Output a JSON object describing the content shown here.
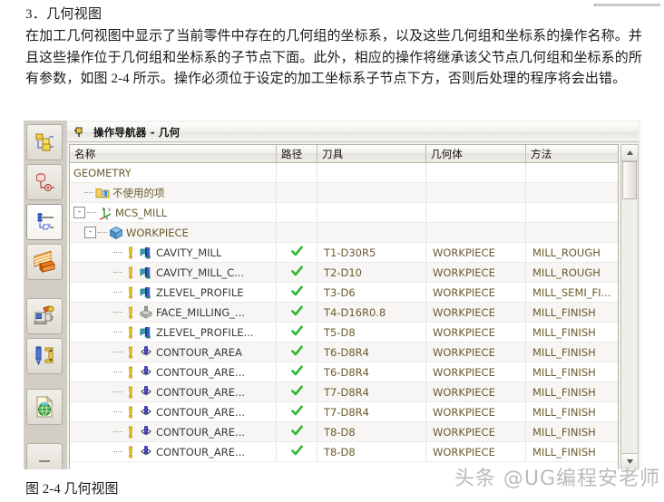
{
  "document": {
    "heading": "3．几何视图",
    "paragraph": "在加工几何视图中显示了当前零件中存在的几何组的坐标系，以及这些几何组和坐标系的操作名称。并且这些操作位于几何组和坐标系的子节点下面。此外，相应的操作将继承该父节点几何组和坐标系的所有参数，如图 2-4 所示。操作必须位于设定的加工坐标系子节点下方，否则后处理的程序将会出错。",
    "caption": "图 2-4  几何视图",
    "watermark": "头条 @UG编程安老师"
  },
  "window": {
    "pin_icon": "pin-icon",
    "title": "操作导航器 - 几何"
  },
  "toolbar": {
    "buttons": [
      {
        "name": "program-order-view",
        "icon": "program-order-icon",
        "active": false
      },
      {
        "name": "machine-tool-view",
        "icon": "machine-tool-icon",
        "active": false
      },
      {
        "name": "geometry-view",
        "icon": "geometry-view-icon",
        "active": true
      },
      {
        "name": "machining-method-view",
        "icon": "machining-method-icon",
        "active": false
      },
      {
        "name": "workpiece-view",
        "icon": "workpiece-icon",
        "active": false
      },
      {
        "name": "tool-view",
        "icon": "tool-icon",
        "active": false
      },
      {
        "name": "output-view",
        "icon": "output-icon",
        "active": false
      }
    ]
  },
  "table": {
    "columns": [
      {
        "key": "name",
        "label": "名称"
      },
      {
        "key": "path",
        "label": "路径"
      },
      {
        "key": "tool",
        "label": "刀具"
      },
      {
        "key": "geom",
        "label": "几何体"
      },
      {
        "key": "method",
        "label": "方法"
      }
    ],
    "rows": [
      {
        "level": 0,
        "icon": "none",
        "expander": "",
        "name": "GEOMETRY",
        "path": "",
        "tool": "",
        "geom": "",
        "method": ""
      },
      {
        "level": 1,
        "icon": "folder-unused",
        "expander": "",
        "name": "不使用的项",
        "path": "",
        "tool": "",
        "geom": "",
        "method": ""
      },
      {
        "level": 0,
        "icon": "mcs-axis",
        "expander": "-",
        "name": "MCS_MILL",
        "path": "",
        "tool": "",
        "geom": "",
        "method": ""
      },
      {
        "level": 1,
        "icon": "workpiece-box",
        "expander": "-",
        "name": "WORKPIECE",
        "path": "",
        "tool": "",
        "geom": "",
        "method": ""
      },
      {
        "level": 3,
        "icon": "cavity-mill",
        "expander": "",
        "name": "CAVITY_MILL",
        "path": "ok",
        "tool": "T1-D30R5",
        "geom": "WORKPIECE",
        "method": "MILL_ROUGH"
      },
      {
        "level": 3,
        "icon": "cavity-mill",
        "expander": "",
        "name": "CAVITY_MILL_C...",
        "path": "ok",
        "tool": "T2-D10",
        "geom": "WORKPIECE",
        "method": "MILL_ROUGH"
      },
      {
        "level": 3,
        "icon": "cavity-mill",
        "expander": "",
        "name": "ZLEVEL_PROFILE",
        "path": "ok",
        "tool": "T3-D6",
        "geom": "WORKPIECE",
        "method": "MILL_SEMI_FI..."
      },
      {
        "level": 3,
        "icon": "face-milling",
        "expander": "",
        "name": "FACE_MILLING_...",
        "path": "ok",
        "tool": "T4-D16R0.8",
        "geom": "WORKPIECE",
        "method": "MILL_FINISH"
      },
      {
        "level": 3,
        "icon": "cavity-mill",
        "expander": "",
        "name": "ZLEVEL_PROFILE...",
        "path": "ok",
        "tool": "T5-D8",
        "geom": "WORKPIECE",
        "method": "MILL_FINISH"
      },
      {
        "level": 3,
        "icon": "contour-area",
        "expander": "",
        "name": "CONTOUR_AREA",
        "path": "ok",
        "tool": "T6-D8R4",
        "geom": "WORKPIECE",
        "method": "MILL_FINISH"
      },
      {
        "level": 3,
        "icon": "contour-area",
        "expander": "",
        "name": "CONTOUR_ARE...",
        "path": "ok",
        "tool": "T6-D8R4",
        "geom": "WORKPIECE",
        "method": "MILL_FINISH"
      },
      {
        "level": 3,
        "icon": "contour-area",
        "expander": "",
        "name": "CONTOUR_ARE...",
        "path": "ok",
        "tool": "T7-D8R4",
        "geom": "WORKPIECE",
        "method": "MILL_FINISH"
      },
      {
        "level": 3,
        "icon": "contour-area",
        "expander": "",
        "name": "CONTOUR_ARE...",
        "path": "ok",
        "tool": "T7-D8R4",
        "geom": "WORKPIECE",
        "method": "MILL_FINISH"
      },
      {
        "level": 3,
        "icon": "contour-area",
        "expander": "",
        "name": "CONTOUR_ARE...",
        "path": "ok",
        "tool": "T8-D8",
        "geom": "WORKPIECE",
        "method": "MILL_FINISH"
      },
      {
        "level": 3,
        "icon": "contour-area",
        "expander": "",
        "name": "CONTOUR_ARE...",
        "path": "ok",
        "tool": "T8-D8",
        "geom": "WORKPIECE",
        "method": "MILL_FINISH"
      }
    ]
  },
  "scrollbar": {
    "up_arrow": "▲",
    "down_arrow": "▼"
  },
  "colors": {
    "tree_text": "#6b5b2e",
    "check_green": "#2fb62f",
    "header_bg": "#eceae5"
  }
}
